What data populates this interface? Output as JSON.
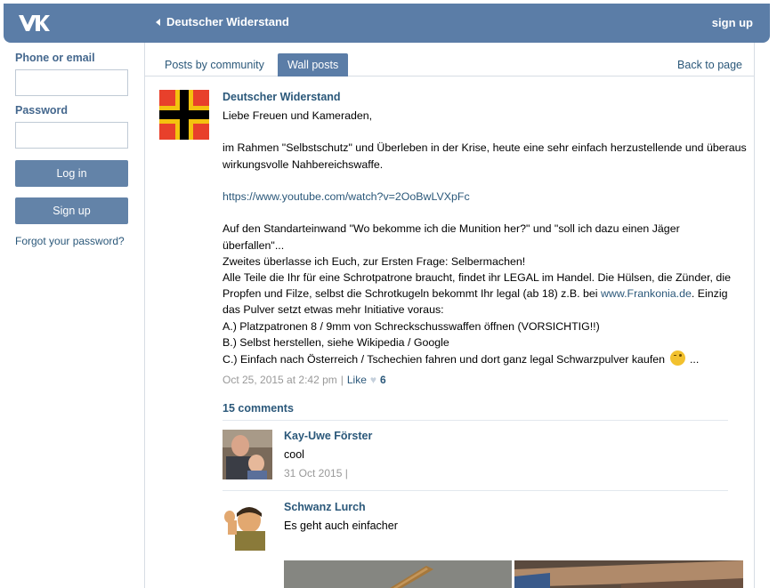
{
  "header": {
    "logo": "vk-logo",
    "back_label": "Deutscher Widerstand",
    "signup": "sign up"
  },
  "sidebar": {
    "phone_label": "Phone or email",
    "password_label": "Password",
    "phone_value": "",
    "password_value": "",
    "login_button": "Log in",
    "signup_button": "Sign up",
    "forgot": "Forgot your password?"
  },
  "tabs": {
    "posts_by_community": "Posts by community",
    "wall_posts": "Wall posts",
    "back_to_page": "Back to page"
  },
  "post": {
    "author": "Deutscher Widerstand",
    "lines": [
      "Liebe Freuen und Kameraden,",
      "",
      "im Rahmen \"Selbstschutz\" und Überleben in der Krise, heute eine sehr einfach herzustellende und überaus",
      "wirkungsvolle Nahbereichswaffe.",
      "",
      "",
      "",
      "Auf den Standarteinwand \"Wo bekomme ich die Munition her?\" und \"soll ich dazu einen Jäger",
      "überfallen\"...",
      "Zweites überlasse ich Euch, zur Ersten Frage: Selbermachen!",
      "Alle Teile die Ihr für eine Schrotpatrone braucht, findet ihr LEGAL im Handel. Die Hülsen, die Zünder, die",
      "",
      "das Pulver setzt etwas mehr Initiative voraus:",
      "A.) Platzpatronen 8 / 9mm von Schreckschusswaffen öffnen (VORSICHTIG!!)",
      "B.) Selbst herstellen, siehe Wikipedia / Google",
      ""
    ],
    "link_youtube": "https://www.youtube.com/watch?v=2OoBwLVXpFc",
    "line_frankonia_before": "Propfen und Filze, selbst die Schrotkugeln bekommt Ihr legal (ab 18) z.B. bei ",
    "link_frankonia": "www.Frankonia.de",
    "line_frankonia_after": ". Einzig",
    "line_last_before": "C.) Einfach nach Österreich / Tschechien fahren und dort ganz legal Schwarzpulver kaufen",
    "line_last_after": " ...",
    "emoji": "wink-emoji",
    "date": "Oct 25, 2015 at 2:42 pm",
    "separator": "|",
    "like_label": "Like",
    "like_count": "6"
  },
  "comments": {
    "count_label": "15 comments",
    "items": [
      {
        "author": "Kay-Uwe Förster",
        "text": "cool",
        "date": "31 Oct 2015",
        "separator": "|"
      },
      {
        "author": "Schwanz Lurch",
        "text": "Es geht auch einfacher"
      }
    ]
  },
  "colors": {
    "header_bg": "#5b7da7",
    "link": "#2b587a",
    "button_bg": "#6383a8",
    "flag_red": "#e8402b",
    "flag_gold": "#f4c20f",
    "flag_black": "#000000"
  }
}
